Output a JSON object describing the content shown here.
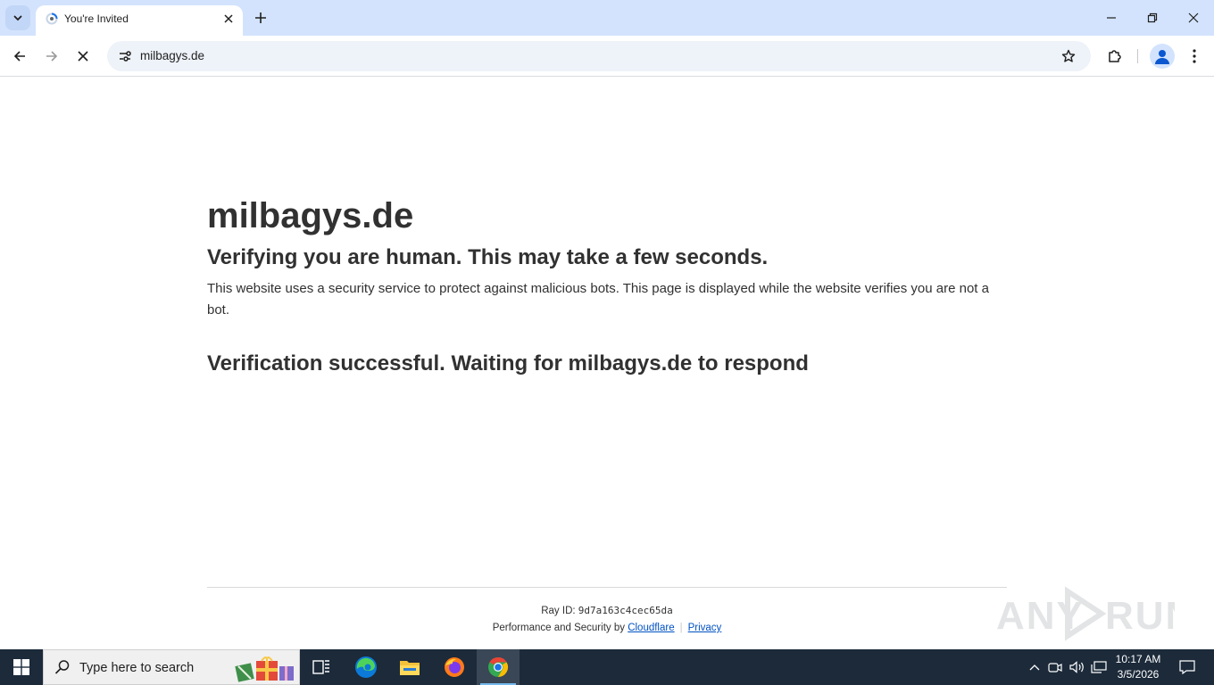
{
  "browser": {
    "tab": {
      "title": "You're Invited",
      "favicon": "loading-spinner-icon"
    },
    "address_bar": {
      "url": "milbagys.de"
    },
    "colors": {
      "frame": "#d3e3fd",
      "omnibox": "#eef2f9"
    }
  },
  "page": {
    "site_title": "milbagys.de",
    "heading": "Verifying you are human. This may take a few seconds.",
    "description": "This website uses a security service to protect against malicious bots. This page is displayed while the website verifies you are not a bot.",
    "status": "Verification successful. Waiting for milbagys.de to respond",
    "footer": {
      "ray_label": "Ray ID: ",
      "ray_id": "9d7a163c4cec65da",
      "perf_text": "Performance and Security by ",
      "cloudflare_link": "Cloudflare",
      "privacy_link": "Privacy"
    },
    "link_color": "#0051c3"
  },
  "watermark": {
    "text": "ANY RUN"
  },
  "taskbar": {
    "search_placeholder": "Type here to search",
    "clock_time": "10:17 AM",
    "clock_date": "3/5/2026",
    "apps": [
      "task-view-icon",
      "edge-icon",
      "file-explorer-icon",
      "firefox-icon",
      "chrome-icon"
    ],
    "background": "#1c2a3a"
  }
}
